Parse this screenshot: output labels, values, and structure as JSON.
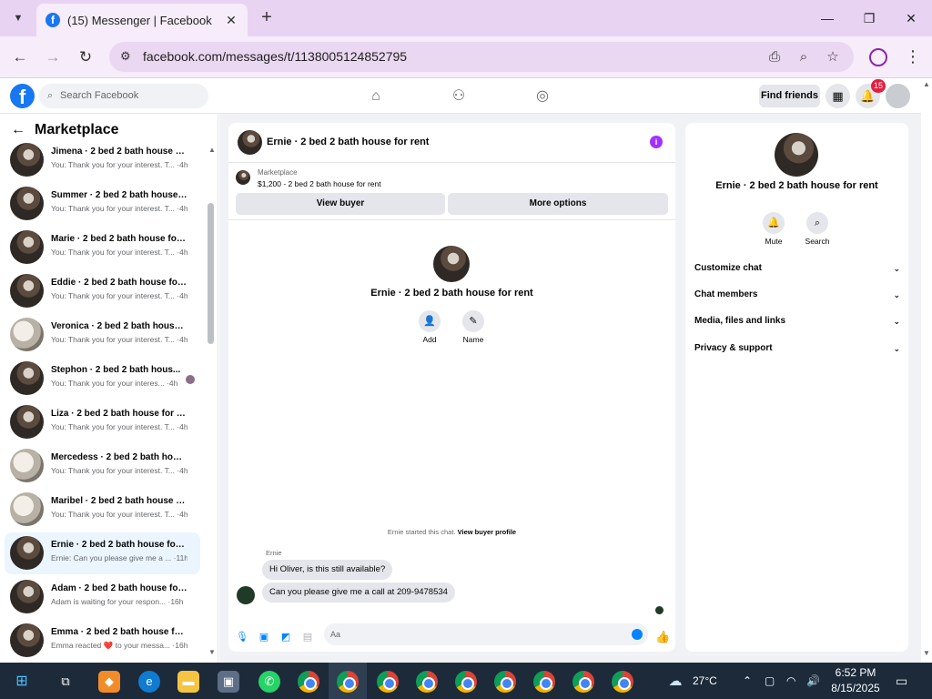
{
  "browser": {
    "tab_title": "(15) Messenger | Facebook",
    "url": "facebook.com/messages/t/1138005124852795"
  },
  "fb": {
    "search_placeholder": "Search Facebook",
    "find_friends": "Find friends",
    "notif_count": "15"
  },
  "left": {
    "title": "Marketplace",
    "conversations": [
      {
        "name": "Jimena · 2 bed 2 bath house fo...",
        "preview": "You: Thank you for your interest. T... ·4h"
      },
      {
        "name": "Summer · 2 bed 2 bath house f...",
        "preview": "You: Thank you for your interest. T... ·4h"
      },
      {
        "name": "Marie · 2 bed 2 bath house for ...",
        "preview": "You: Thank you for your interest. T... ·4h"
      },
      {
        "name": "Eddie · 2 bed 2 bath house for ...",
        "preview": "You: Thank you for your interest. T... ·4h"
      },
      {
        "name": "Veronica · 2 bed 2 bath house f...",
        "preview": "You: Thank you for your interest. T... ·4h"
      },
      {
        "name": "Stephon · 2 bed 2 bath hous...",
        "preview": "You: Thank you for your interes... ·4h"
      },
      {
        "name": "Liza · 2 bed 2 bath house for rent",
        "preview": "You: Thank you for your interest. T... ·4h"
      },
      {
        "name": "Mercedess · 2 bed 2 bath hous...",
        "preview": "You: Thank you for your interest. T... ·4h"
      },
      {
        "name": "Maribel · 2 bed 2 bath house fo...",
        "preview": "You: Thank you for your interest. T... ·4h"
      },
      {
        "name": "Ernie · 2 bed 2 bath house for r...",
        "preview": "Ernie: Can you please give me a ... ·11h"
      },
      {
        "name": "Adam · 2 bed 2 bath house for ...",
        "preview": "Adam is waiting for your respon... ·16h"
      },
      {
        "name": "Emma · 2 bed 2 bath house for ...",
        "preview": "Emma reacted ❤️ to your messa... ·16h"
      }
    ]
  },
  "chat": {
    "title": "Ernie · 2 bed 2 bath house for rent",
    "marketplace_label": "Marketplace",
    "listing": "$1,200 - 2 bed 2 bath house for rent",
    "view_buyer": "View buyer",
    "more_options": "More options",
    "profile_name": "Ernie · 2 bed 2 bath house for rent",
    "add_label": "Add",
    "name_label": "Name",
    "started_note": "Ernie started this chat.",
    "view_buyer_profile": "View buyer profile",
    "sender": "Ernie",
    "msg1": "Hi Oliver, is this still available?",
    "msg2": "Can you please give me a call at 209-9478534",
    "composer_placeholder": "Aa"
  },
  "right": {
    "name": "Ernie · 2 bed 2 bath house for rent",
    "mute": "Mute",
    "search": "Search",
    "sections": [
      "Customize chat",
      "Chat members",
      "Media, files and links",
      "Privacy & support"
    ]
  },
  "taskbar": {
    "temperature": "27°C",
    "time": "6:52 PM",
    "date": "8/15/2025"
  }
}
